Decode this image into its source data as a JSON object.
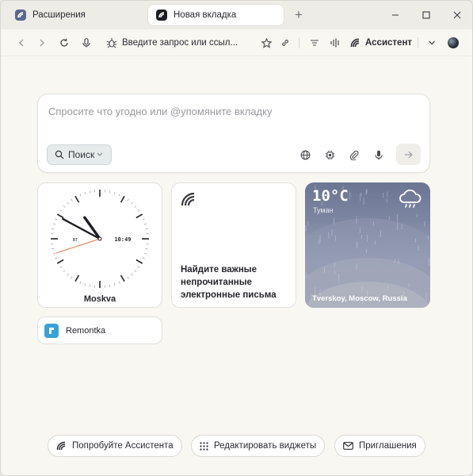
{
  "tabs": [
    {
      "label": "Расширения",
      "active": false
    },
    {
      "label": "Новая вкладка",
      "active": true
    }
  ],
  "toolbar": {
    "address_placeholder": "Введите запрос или ссыл...",
    "assistant_label": "Ассистент"
  },
  "search": {
    "placeholder": "Спросите что угодно или @упомяните вкладку",
    "mode_label": "Поиск"
  },
  "clock": {
    "city": "Moskva",
    "time": "10:49",
    "weekday": "ВТ",
    "hours": 10,
    "minutes": 49,
    "seconds": 42
  },
  "mail_widget": {
    "text": "Найдите важные непрочитанные электронные письма"
  },
  "weather": {
    "temperature": "10°C",
    "condition": "Туман",
    "location": "Tverskoy, Moscow, Russia"
  },
  "bookmark": {
    "label": "Remontka"
  },
  "bottom_actions": {
    "try_assistant": "Попробуйте Ассистента",
    "edit_widgets": "Редактировать виджеты",
    "invitations": "Приглашения"
  },
  "colors": {
    "accent_link": "#38a1d9",
    "clock_second_hand": "#e0773a",
    "weather_bg": "#7d86a1"
  }
}
